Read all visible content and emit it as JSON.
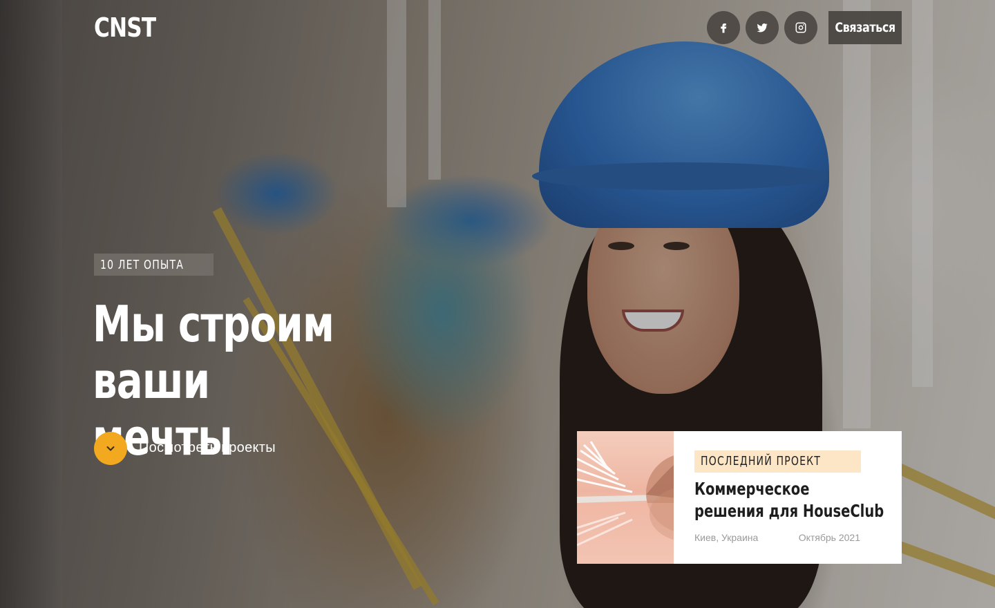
{
  "header": {
    "logo": "CNST",
    "contact_label": "Связаться",
    "social": [
      {
        "name": "facebook",
        "icon": "facebook-icon"
      },
      {
        "name": "twitter",
        "icon": "twitter-icon"
      },
      {
        "name": "instagram",
        "icon": "instagram-icon"
      }
    ]
  },
  "hero": {
    "badge": "10 ЛЕТ ОПЫТА",
    "headline_line1": "Мы строим ваши",
    "headline_line2": "мечты",
    "cta_label": "Посмотреть проекты",
    "cta_icon": "chevron-down-icon"
  },
  "project_card": {
    "tag": "ПОСЛЕДНИЙ ПРОЕКТ",
    "title_line1": "Коммерческое",
    "title_line2": "решения для HouseClub",
    "location": "Киев, Украина",
    "date": "Октябрь 2021"
  },
  "colors": {
    "accent": "#f2a91f",
    "tag_bg": "#fde6c6",
    "text_light": "#ffffff",
    "text_dark": "#1e1e1e",
    "meta": "#9a9a9a"
  }
}
